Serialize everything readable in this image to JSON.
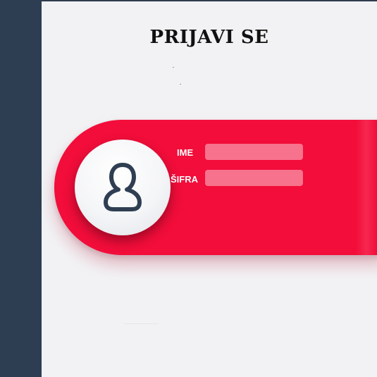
{
  "login": {
    "title": "PRIJAVI SE",
    "username_label": "IME",
    "username_value": "",
    "password_label": "ŠIFRA",
    "password_value": ""
  },
  "icons": {
    "avatar": "user-icon"
  },
  "colors": {
    "sidebar": "#2d3e52",
    "background": "#f2f2f4",
    "card": "#f20d3a",
    "input_fill": "#fb6f89",
    "icon_stroke": "#2f3e52"
  }
}
